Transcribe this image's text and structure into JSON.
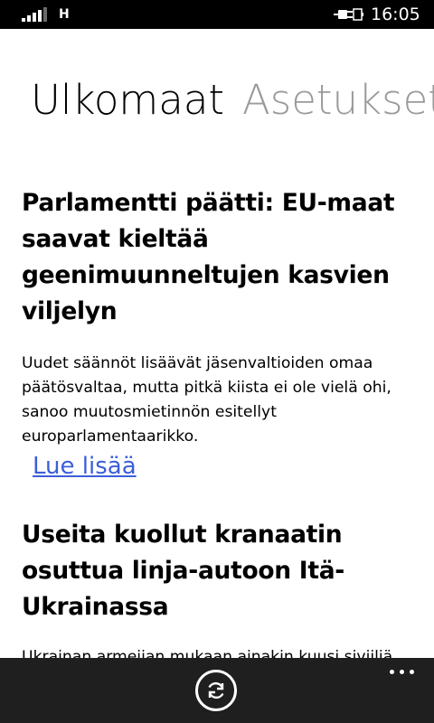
{
  "status_bar": {
    "network_type": "H",
    "time": "16:05",
    "signal_icon": "signal-strength-icon",
    "battery_icon": "battery-charging-icon"
  },
  "pivot": {
    "tabs": [
      {
        "label": "Ulkomaat",
        "active": true
      },
      {
        "label": "Asetukset",
        "active": false
      }
    ]
  },
  "articles": [
    {
      "title": "Parlamentti päätti: EU-maat saavat kieltää geenimuunneltujen kasvien viljelyn",
      "summary": "Uudet säännöt lisäävät jäsenvaltioiden omaa päätösvaltaa, mutta pitkä kiista ei ole vielä ohi, sanoo muutosmietinnön esitellyt europarlamentaarikko.",
      "read_more": "Lue lisää"
    },
    {
      "title": "Useita kuollut kranaatin osuttua linja-autoon Itä-Ukrainassa",
      "summary": "Ukrainan armeijan mukaan ainakin kuusi siviiliä"
    }
  ],
  "app_bar": {
    "refresh_icon": "refresh-icon",
    "more_icon": "more-ellipsis-icon"
  },
  "colors": {
    "link": "#3b5fd9",
    "inactive_tab": "#9a9a9a",
    "app_bar": "#1f1f1f",
    "status_bar": "#000000"
  }
}
